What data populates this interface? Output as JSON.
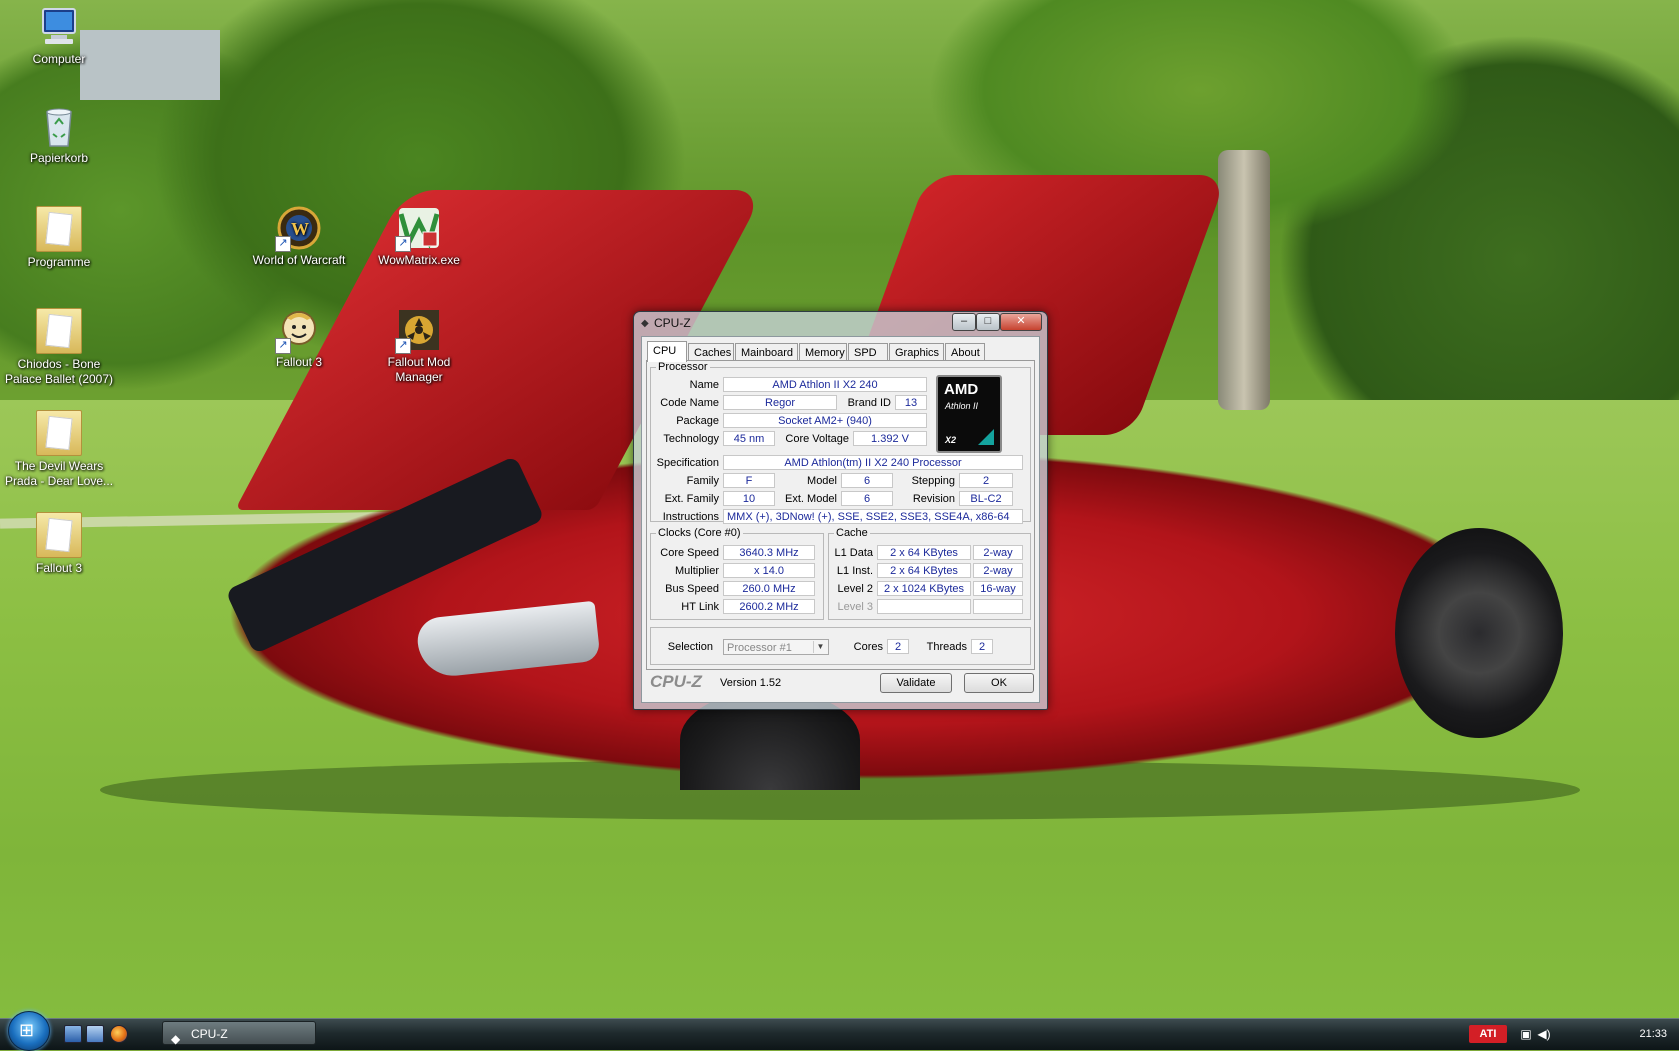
{
  "desktop": {
    "icons": [
      {
        "label": "Computer",
        "icon": "computer-icon"
      },
      {
        "label": "Papierkorb",
        "icon": "recycle-bin-icon"
      },
      {
        "label": "Programme",
        "icon": "folder-icon"
      },
      {
        "label": "Chiodos - Bone Palace Ballet (2007)",
        "icon": "folder-icon"
      },
      {
        "label": "The Devil Wears Prada - Dear Love...",
        "icon": "folder-icon"
      },
      {
        "label": "Fallout 3",
        "icon": "folder-icon"
      },
      {
        "label": "World of Warcraft",
        "icon": "wow-icon"
      },
      {
        "label": "WowMatrix.exe",
        "icon": "wowmatrix-icon"
      },
      {
        "label": "Fallout 3",
        "icon": "vault-boy-icon"
      },
      {
        "label": "Fallout Mod Manager",
        "icon": "fomm-icon"
      }
    ]
  },
  "taskbar": {
    "task_label": "CPU-Z",
    "clock": "21:33",
    "ati_label": "ATI"
  },
  "window": {
    "title": "CPU-Z",
    "tabs": [
      "CPU",
      "Caches",
      "Mainboard",
      "Memory",
      "SPD",
      "Graphics",
      "About"
    ],
    "active_tab": "CPU",
    "processor": {
      "legend": "Processor",
      "name_label": "Name",
      "name": "AMD Athlon II X2 240",
      "codename_label": "Code Name",
      "codename": "Regor",
      "brandid_label": "Brand ID",
      "brandid": "13",
      "package_label": "Package",
      "package": "Socket AM2+ (940)",
      "technology_label": "Technology",
      "technology": "45 nm",
      "corevoltage_label": "Core Voltage",
      "corevoltage": "1.392 V",
      "spec_label": "Specification",
      "spec": "AMD Athlon(tm) II X2 240 Processor",
      "family_label": "Family",
      "family": "F",
      "model_label": "Model",
      "model": "6",
      "stepping_label": "Stepping",
      "stepping": "2",
      "extfamily_label": "Ext. Family",
      "extfamily": "10",
      "extmodel_label": "Ext. Model",
      "extmodel": "6",
      "revision_label": "Revision",
      "revision": "BL-C2",
      "instructions_label": "Instructions",
      "instructions": "MMX (+), 3DNow! (+), SSE, SSE2, SSE3, SSE4A, x86-64",
      "logo": {
        "brand": "AMD",
        "line": "Athlon II",
        "suffix": "X2"
      }
    },
    "clocks": {
      "legend": "Clocks (Core #0)",
      "corespeed_label": "Core Speed",
      "corespeed": "3640.3 MHz",
      "multiplier_label": "Multiplier",
      "multiplier": "x 14.0",
      "busspeed_label": "Bus Speed",
      "busspeed": "260.0 MHz",
      "htlink_label": "HT Link",
      "htlink": "2600.2 MHz"
    },
    "cache": {
      "legend": "Cache",
      "l1data_label": "L1 Data",
      "l1data": "2 x 64 KBytes",
      "l1data_way": "2-way",
      "l1inst_label": "L1 Inst.",
      "l1inst": "2 x 64 KBytes",
      "l1inst_way": "2-way",
      "level2_label": "Level 2",
      "level2": "2 x 1024 KBytes",
      "level2_way": "16-way",
      "level3_label": "Level 3",
      "level3": "",
      "level3_way": ""
    },
    "selection": {
      "selection_label": "Selection",
      "selection_value": "Processor #1",
      "cores_label": "Cores",
      "cores": "2",
      "threads_label": "Threads",
      "threads": "2"
    },
    "footer": {
      "logo": "CPU-Z",
      "version": "Version 1.52",
      "validate_label": "Validate",
      "ok_label": "OK"
    }
  }
}
